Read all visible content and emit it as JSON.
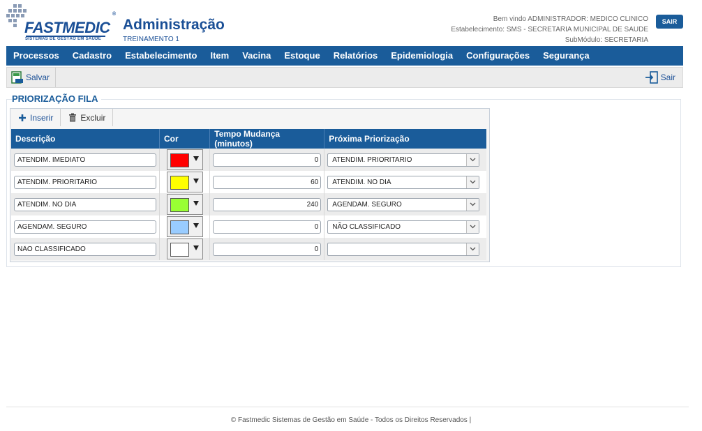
{
  "header": {
    "logo_text": "FASTMEDIC",
    "logo_tag": "SISTEMAS DE GESTÃO EM SAÚDE",
    "app_title": "Administração",
    "app_subtitle": "TREINAMENTO 1",
    "welcome_line1": "Bem vindo ADMINISTRADOR: MEDICO CLINICO",
    "welcome_line2": "Estabelecimento: SMS - SECRETARIA MUNICIPAL DE SAUDE",
    "welcome_line3": "SubMódulo: SECRETARIA",
    "logout_label": "SAIR"
  },
  "menu": {
    "items": [
      "Processos",
      "Cadastro",
      "Estabelecimento",
      "Item",
      "Vacina",
      "Estoque",
      "Relatórios",
      "Epidemiologia",
      "Configurações",
      "Segurança"
    ]
  },
  "toolbar": {
    "save_label": "Salvar",
    "exit_label": "Sair"
  },
  "panel": {
    "title": "PRIORIZAÇÃO FILA",
    "insert_label": "Inserir",
    "delete_label": "Excluir"
  },
  "grid": {
    "columns": [
      "Descrição",
      "Cor",
      "Tempo Mudança (minutos)",
      "Próxima Priorização"
    ],
    "rows": [
      {
        "descricao": "ATENDIM. IMEDIATO",
        "cor": "#ff0000",
        "tempo": "0",
        "proxima": "ATENDIM. PRIORITARIO"
      },
      {
        "descricao": "ATENDIM. PRIORITARIO",
        "cor": "#ffff00",
        "tempo": "60",
        "proxima": "ATENDIM. NO DIA"
      },
      {
        "descricao": "ATENDIM. NO DIA",
        "cor": "#99ff33",
        "tempo": "240",
        "proxima": "AGENDAM. SEGURO"
      },
      {
        "descricao": "AGENDAM. SEGURO",
        "cor": "#99ccff",
        "tempo": "0",
        "proxima": "NÃO CLASSIFICADO"
      },
      {
        "descricao": "NÃO CLASSIFICADO",
        "cor": "#ffffff",
        "tempo": "0",
        "proxima": ""
      }
    ]
  },
  "footer": {
    "text": "© Fastmedic Sistemas de Gestão em Saúde - Todos os Direitos Reservados |"
  },
  "colors": {
    "brand_blue": "#1a5c9a",
    "logo_blue": "#1a4f96"
  }
}
